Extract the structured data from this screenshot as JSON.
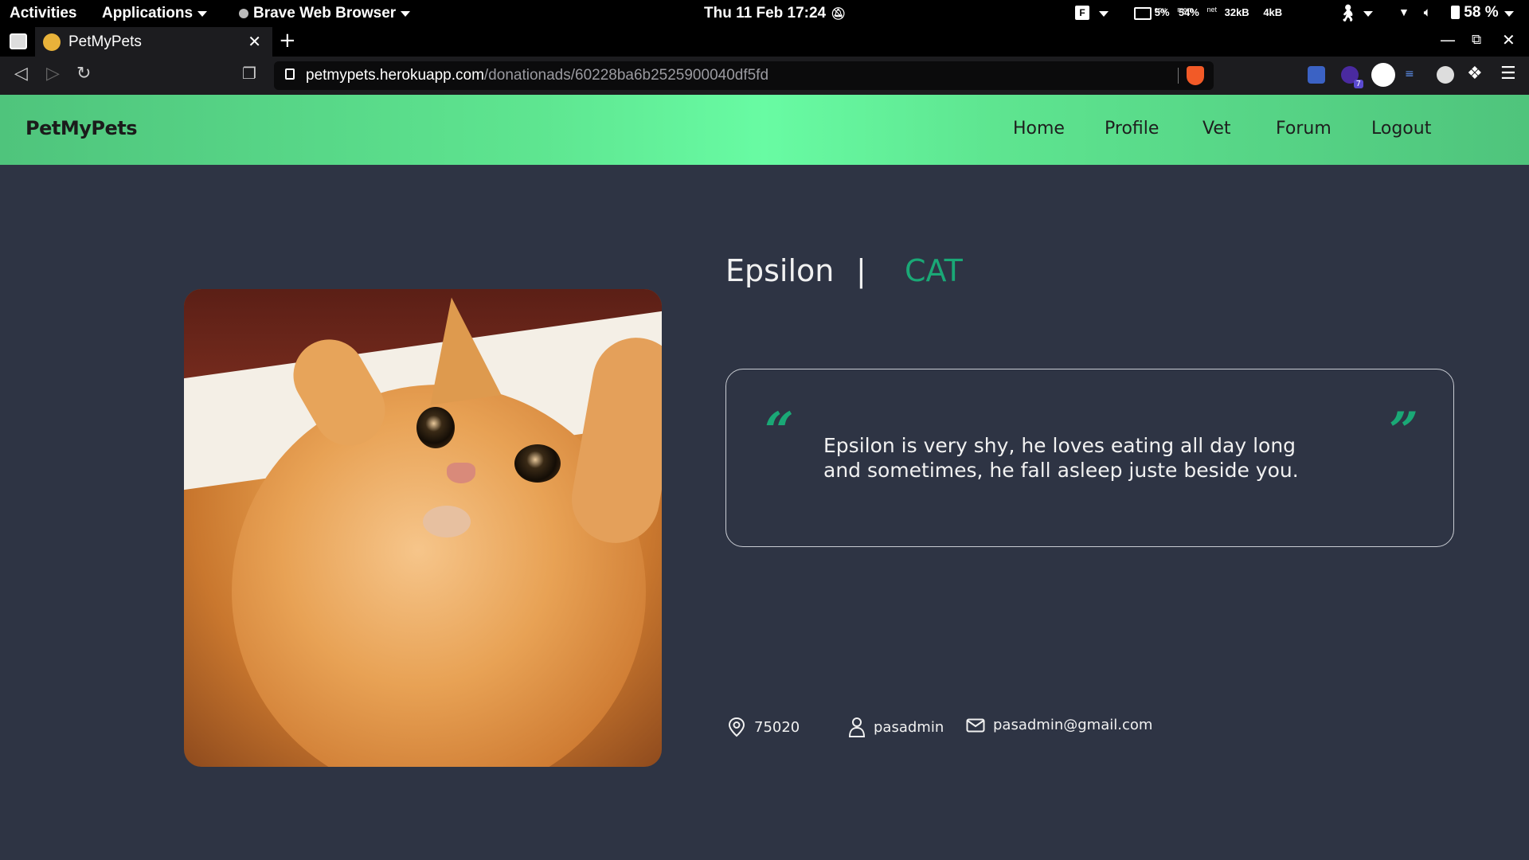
{
  "system_bar": {
    "activities": "Activities",
    "applications": "Applications",
    "app_name": "Brave Web Browser",
    "datetime": "Thu 11 Feb  17:24",
    "cpu_label": "cpu",
    "cpu_value": "5%",
    "mem_label": "mem",
    "mem_value": "54%",
    "net_label": "net",
    "net_down": "32kB",
    "net_up": "4kB",
    "battery": "58 %"
  },
  "browser": {
    "tab_title": "PetMyPets",
    "url_domain": "petmypets.herokuapp.com",
    "url_path": "/donationads/60228ba6b2525900040df5fd",
    "extension_badge": "7"
  },
  "site": {
    "brand": "PetMyPets",
    "nav": [
      "Home",
      "Profile",
      "Vet",
      "Forum",
      "Logout"
    ]
  },
  "pet": {
    "name": "Epsilon",
    "separator": "|",
    "type": "CAT",
    "description": "Epsilon is very shy, he loves eating all day long and sometimes, he fall asleep juste beside you.",
    "quote_open": "“",
    "quote_close": "”",
    "postal_code": "75020",
    "owner": "pasadmin",
    "email": "pasadmin@gmail.com"
  },
  "colors": {
    "accent": "#1aa876",
    "background": "#2e3444",
    "header_gradient_center": "#68fba3"
  }
}
